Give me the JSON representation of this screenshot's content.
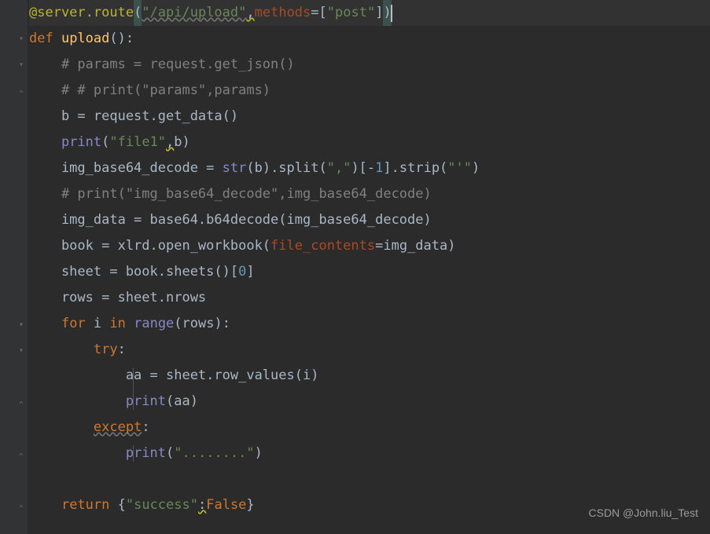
{
  "theme": {
    "background": "#2b2b2b",
    "gutter": "#313335",
    "text": "#a9b7c6",
    "keyword": "#cc7832",
    "function": "#ffc66d",
    "string": "#6a8759",
    "comment": "#808080",
    "decorator": "#bbb529",
    "number": "#6897bb",
    "builtin": "#8888c6",
    "kwarg": "#aa4926"
  },
  "code": {
    "l1_dec_at": "@server.route",
    "l1_paren_open": "(",
    "l1_str1": "\"/api/upload\"",
    "l1_comma": ",",
    "l1_methods": "methods",
    "l1_eq": "=[",
    "l1_str2": "\"post\"",
    "l1_close": "]",
    "l1_paren_close": ")",
    "l2_def": "def ",
    "l2_name": "upload",
    "l2_rest": "():",
    "l3": "    # params = request.get_json()",
    "l4": "    # # print(\"params\",params)",
    "l5_a": "    b = request.get_data()",
    "l6_a": "    ",
    "l6_print": "print",
    "l6_b": "(",
    "l6_str": "\"file1\"",
    "l6_c": ",",
    "l6_d": "b)",
    "l7_a": "    img_base64_decode = ",
    "l7_str": "str",
    "l7_b": "(b).split(",
    "l7_s1": "\",\"",
    "l7_c": ")[-",
    "l7_n1": "1",
    "l7_d": "].strip(",
    "l7_s2": "\"'\"",
    "l7_e": ")",
    "l8": "    # print(\"img_base64_decode\",img_base64_decode)",
    "l9_a": "    img_data = base64.b64decode(img_base64_decode)",
    "l10_a": "    book = xlrd.open_workbook(",
    "l10_kw": "file_contents",
    "l10_b": "=img_data)",
    "l11_a": "    sheet = book.sheets()[",
    "l11_n": "0",
    "l11_b": "]",
    "l12": "    rows = sheet.nrows",
    "l13_a": "    ",
    "l13_for": "for ",
    "l13_b": "i ",
    "l13_in": "in ",
    "l13_range": "range",
    "l13_c": "(rows):",
    "l14_a": "        ",
    "l14_try": "try",
    "l14_b": ":",
    "l15": "            aa = sheet.row_values(i)",
    "l16_a": "            ",
    "l16_print": "print",
    "l16_b": "(aa)",
    "l17_a": "        ",
    "l17_except": "except",
    "l17_b": ":",
    "l18_a": "            ",
    "l18_print": "print",
    "l18_b": "(",
    "l18_str": "\"........\"",
    "l18_c": ")",
    "l19": "",
    "l20_a": "    ",
    "l20_return": "return ",
    "l20_b": "{",
    "l20_str": "\"success\"",
    "l20_c": ":",
    "l20_false": "False",
    "l20_d": "}"
  },
  "watermark": "CSDN @John.liu_Test",
  "fold_markers": [
    {
      "line": 2,
      "type": "down"
    },
    {
      "line": 3,
      "type": "down"
    },
    {
      "line": 4,
      "type": "up"
    },
    {
      "line": 13,
      "type": "down"
    },
    {
      "line": 14,
      "type": "down"
    },
    {
      "line": 16,
      "type": "up"
    },
    {
      "line": 18,
      "type": "up"
    },
    {
      "line": 20,
      "type": "up"
    }
  ]
}
